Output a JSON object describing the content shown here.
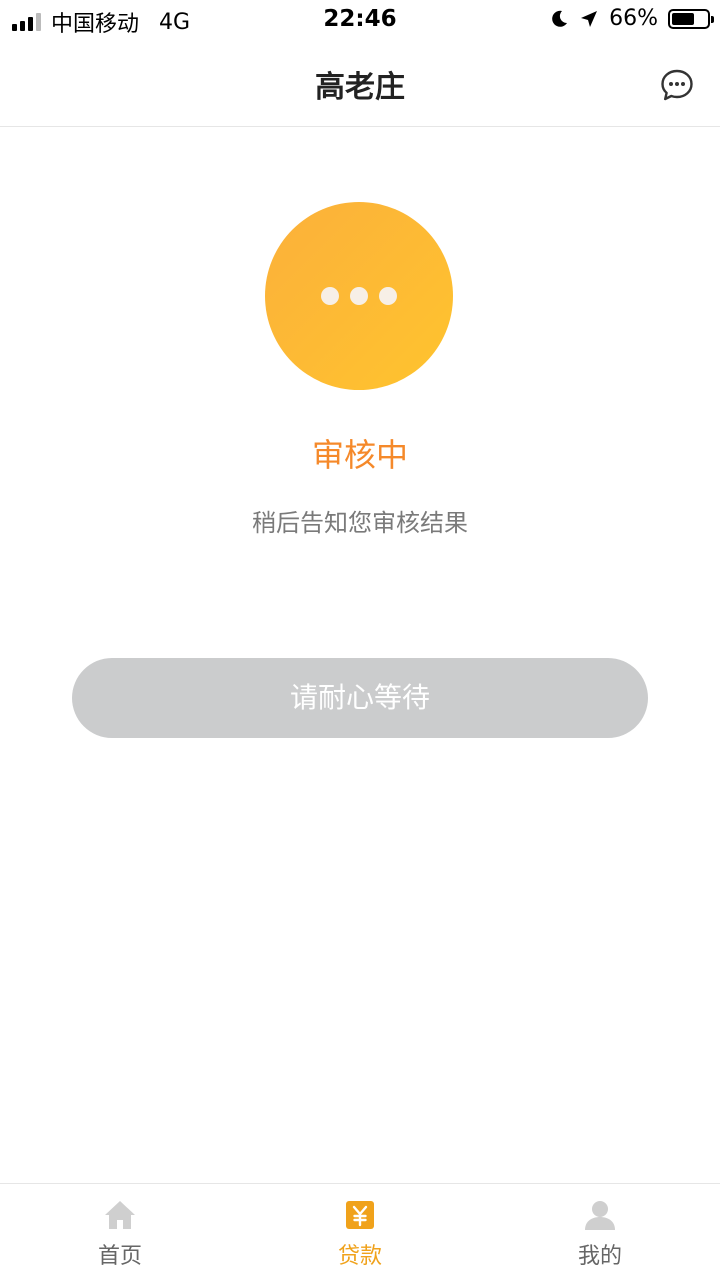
{
  "status_bar": {
    "carrier": "中国移动",
    "network": "4G",
    "time": "22:46",
    "battery_percent": "66%",
    "battery_level": 0.66
  },
  "nav": {
    "title": "高老庄",
    "message_icon": "chat-bubble-icon"
  },
  "status": {
    "icon": "pending-dots-icon",
    "title": "审核中",
    "description": "稍后告知您审核结果",
    "button_label": "请耐心等待"
  },
  "tabs": [
    {
      "label": "首页",
      "icon": "home-icon",
      "active": false
    },
    {
      "label": "贷款",
      "icon": "yuan-icon",
      "active": true
    },
    {
      "label": "我的",
      "icon": "user-icon",
      "active": false
    }
  ],
  "colors": {
    "accent": "#f5892a",
    "tab_active": "#f0a21b",
    "circle_start": "#fbb03b",
    "circle_end": "#ffc42e",
    "button_disabled": "#cbcccd"
  }
}
